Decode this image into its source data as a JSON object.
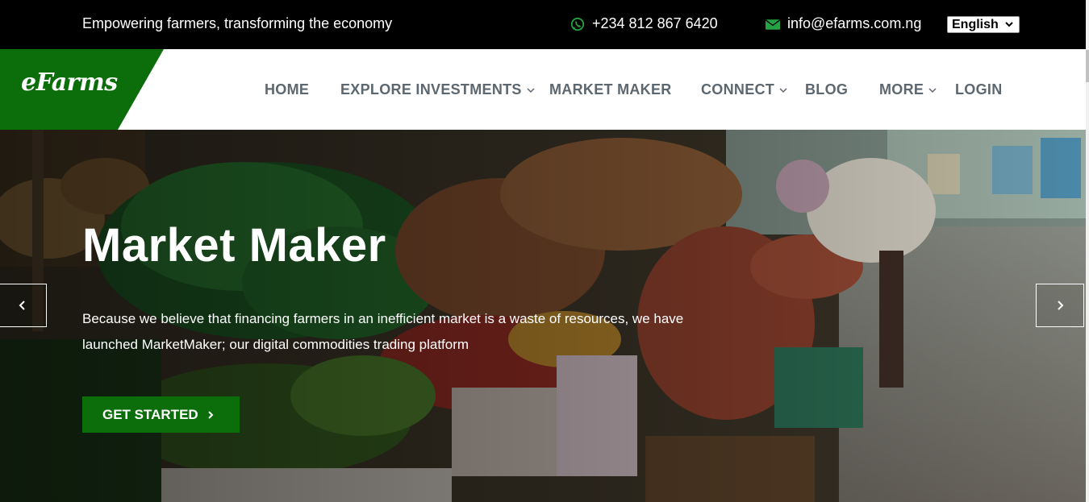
{
  "topbar": {
    "tagline": "Empowering farmers, transforming the economy",
    "phone": "+234 812 867 6420",
    "phone_icon": "whatsapp-icon",
    "email": "info@efarms.com.ng",
    "email_icon": "envelope-icon",
    "language": "English"
  },
  "brand": {
    "logo_text": "eFarms",
    "green": "#0b6e0b",
    "icon_green": "#25a244"
  },
  "nav": {
    "home": "HOME",
    "explore": "EXPLORE INVESTMENTS",
    "market_maker": "MARKET MAKER",
    "connect": "CONNECT",
    "blog": "BLOG",
    "more": "MORE",
    "login": "LOGIN"
  },
  "hero": {
    "title": "Market Maker",
    "description": "Because we believe that financing farmers in an inefficient market is a waste of resources, we have launched MarketMaker; our digital commodities trading platform",
    "cta_label": "GET STARTED"
  }
}
